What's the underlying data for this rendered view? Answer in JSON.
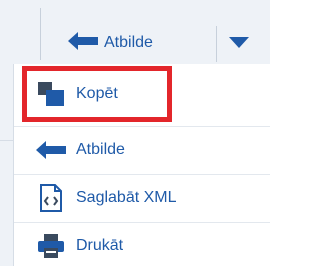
{
  "toolbar": {
    "reply_label": "Atbilde",
    "reply_icon": "arrow-left-icon",
    "dropdown_icon": "chevron-down-icon"
  },
  "menu": {
    "items": [
      {
        "label": "Kopēt",
        "icon": "copy-icon"
      },
      {
        "label": "Atbilde",
        "icon": "arrow-left-icon"
      },
      {
        "label": "Saglabāt XML",
        "icon": "xml-file-icon"
      },
      {
        "label": "Drukāt",
        "icon": "printer-icon"
      }
    ]
  },
  "colors": {
    "accent": "#1f5aa8",
    "highlight_border": "#e3262b",
    "toolbar_bg": "#eef2f7"
  }
}
